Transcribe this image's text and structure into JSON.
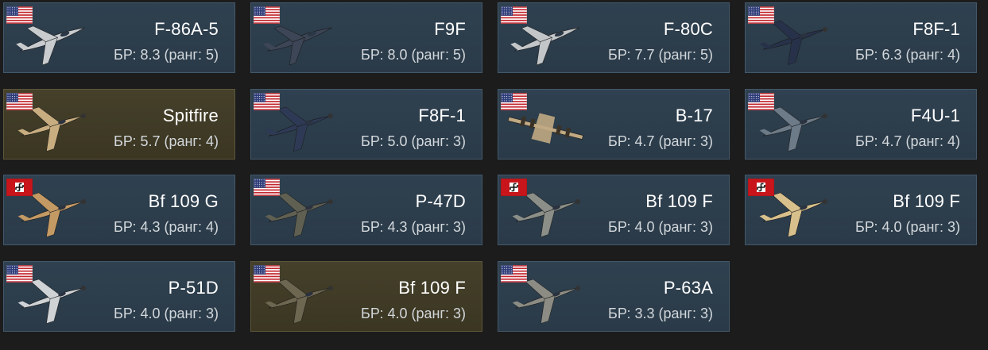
{
  "vehicles": [
    {
      "name": "F-86A-5",
      "br": "БР: 8.3 (ранг: 5)",
      "nation": "usa",
      "premium": false,
      "plane_icon": "jet-silver-icon",
      "plane_color": "#c9ccce"
    },
    {
      "name": "F9F",
      "br": "БР: 8.0 (ранг: 5)",
      "nation": "usa",
      "premium": false,
      "plane_icon": "jet-navy-icon",
      "plane_color": "#3c4657"
    },
    {
      "name": "F-80C",
      "br": "БР: 7.7 (ранг: 5)",
      "nation": "usa",
      "premium": false,
      "plane_icon": "jet-silver-icon",
      "plane_color": "#c3c6c8"
    },
    {
      "name": "F8F-1",
      "br": "БР: 6.3 (ранг: 4)",
      "nation": "usa",
      "premium": false,
      "plane_icon": "fighter-navy-icon",
      "plane_color": "#27324a"
    },
    {
      "name": "Spitfire",
      "br": "БР: 5.7 (ранг: 4)",
      "nation": "usa",
      "premium": true,
      "plane_icon": "fighter-desert-icon",
      "plane_color": "#c8ad80"
    },
    {
      "name": "F8F-1",
      "br": "БР: 5.0 (ранг: 3)",
      "nation": "usa",
      "premium": false,
      "plane_icon": "fighter-navy-icon",
      "plane_color": "#2e3a55"
    },
    {
      "name": "B-17",
      "br": "БР: 4.7 (ранг: 3)",
      "nation": "usa",
      "premium": false,
      "plane_icon": "bomber-desert-icon",
      "plane_color": "#c0a983"
    },
    {
      "name": "F4U-1",
      "br": "БР: 4.7 (ранг: 4)",
      "nation": "usa",
      "premium": false,
      "plane_icon": "fighter-grey-icon",
      "plane_color": "#6d7a87"
    },
    {
      "name": "Bf 109 G",
      "br": "БР: 4.3 (ранг: 4)",
      "nation": "germany",
      "premium": false,
      "plane_icon": "fighter-desert-icon",
      "plane_color": "#c49a64"
    },
    {
      "name": "P-47D",
      "br": "БР: 4.3 (ранг: 3)",
      "nation": "usa",
      "premium": false,
      "plane_icon": "fighter-olive-icon",
      "plane_color": "#5f6052"
    },
    {
      "name": "Bf 109 F",
      "br": "БР: 4.0 (ранг: 3)",
      "nation": "germany",
      "premium": false,
      "plane_icon": "fighter-grey-icon",
      "plane_color": "#8b8f88"
    },
    {
      "name": "Bf 109 F",
      "br": "БР: 4.0 (ранг: 3)",
      "nation": "germany",
      "premium": false,
      "plane_icon": "fighter-desert-icon",
      "plane_color": "#d8c08c"
    },
    {
      "name": "P-51D",
      "br": "БР: 4.0 (ранг: 3)",
      "nation": "usa",
      "premium": false,
      "plane_icon": "fighter-silver-icon",
      "plane_color": "#d0d3d6"
    },
    {
      "name": "Bf 109 F",
      "br": "БР: 4.0 (ранг: 3)",
      "nation": "usa",
      "premium": true,
      "plane_icon": "fighter-olive-icon",
      "plane_color": "#6d6650"
    },
    {
      "name": "P-63A",
      "br": "БР: 3.3 (ранг: 3)",
      "nation": "usa",
      "premium": false,
      "plane_icon": "fighter-grey-icon",
      "plane_color": "#8c8c84"
    }
  ]
}
